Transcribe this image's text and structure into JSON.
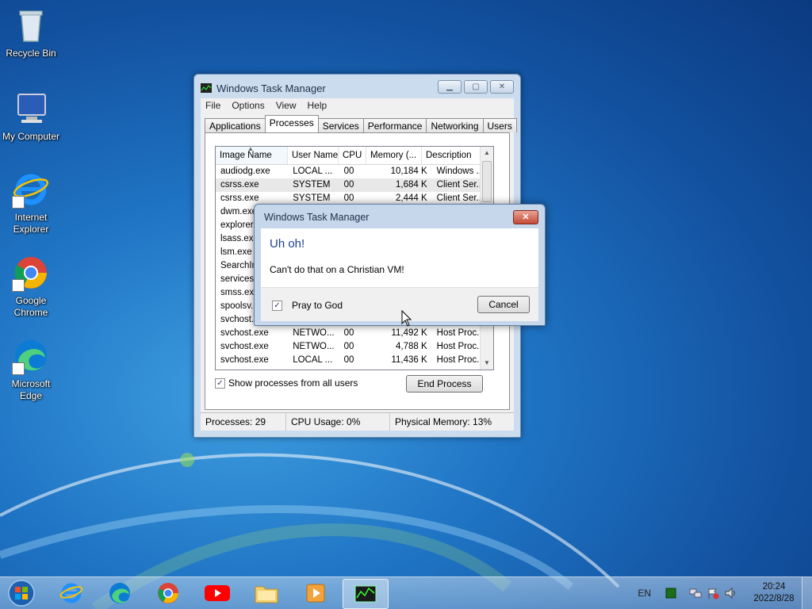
{
  "desktop": {
    "icons": [
      {
        "label": "Recycle Bin"
      },
      {
        "label": "My Computer"
      },
      {
        "label": "Internet Explorer"
      },
      {
        "label": "Google Chrome"
      },
      {
        "label": "Microsoft Edge"
      }
    ]
  },
  "task_manager": {
    "title": "Windows Task Manager",
    "menu": [
      "File",
      "Options",
      "View",
      "Help"
    ],
    "tabs": [
      "Applications",
      "Processes",
      "Services",
      "Performance",
      "Networking",
      "Users"
    ],
    "active_tab": "Processes",
    "columns": [
      "Image Name",
      "User Name",
      "CPU",
      "Memory (...",
      "Description"
    ],
    "rows": [
      {
        "image": "audiodg.exe",
        "user": "LOCAL ...",
        "cpu": "00",
        "mem": "10,184 K",
        "desc": "Windows ..."
      },
      {
        "image": "csrss.exe",
        "user": "SYSTEM",
        "cpu": "00",
        "mem": "1,684 K",
        "desc": "Client Ser..."
      },
      {
        "image": "csrss.exe",
        "user": "SYSTEM",
        "cpu": "00",
        "mem": "2,444 K",
        "desc": "Client Ser..."
      },
      {
        "image": "dwm.exe",
        "user": "",
        "cpu": "",
        "mem": "",
        "desc": ""
      },
      {
        "image": "explorer.exe",
        "user": "",
        "cpu": "",
        "mem": "",
        "desc": ""
      },
      {
        "image": "lsass.exe",
        "user": "",
        "cpu": "",
        "mem": "",
        "desc": ""
      },
      {
        "image": "lsm.exe",
        "user": "",
        "cpu": "",
        "mem": "",
        "desc": ""
      },
      {
        "image": "SearchIndexer.exe",
        "user": "",
        "cpu": "",
        "mem": "",
        "desc": ""
      },
      {
        "image": "services.exe",
        "user": "",
        "cpu": "",
        "mem": "",
        "desc": ""
      },
      {
        "image": "smss.exe",
        "user": "",
        "cpu": "",
        "mem": "",
        "desc": ""
      },
      {
        "image": "spoolsv.exe",
        "user": "",
        "cpu": "",
        "mem": "",
        "desc": ""
      },
      {
        "image": "svchost.exe",
        "user": "",
        "cpu": "",
        "mem": "",
        "desc": ""
      },
      {
        "image": "svchost.exe",
        "user": "NETWO...",
        "cpu": "00",
        "mem": "11,492 K",
        "desc": "Host Proc..."
      },
      {
        "image": "svchost.exe",
        "user": "NETWO...",
        "cpu": "00",
        "mem": "4,788 K",
        "desc": "Host Proc..."
      },
      {
        "image": "svchost.exe",
        "user": "LOCAL ...",
        "cpu": "00",
        "mem": "11,436 K",
        "desc": "Host Proc..."
      }
    ],
    "show_all_label": "Show processes from all users",
    "show_all_checked": true,
    "end_process_label": "End Process",
    "status": {
      "processes": "Processes: 29",
      "cpu": "CPU Usage: 0%",
      "memory": "Physical Memory: 13%"
    }
  },
  "dialog": {
    "title": "Windows Task Manager",
    "heading": "Uh oh!",
    "message": "Can't do that on a Christian VM!",
    "checkbox_label": "Pray to God",
    "checkbox_checked": true,
    "cancel_label": "Cancel"
  },
  "taskbar": {
    "apps": [
      "start-orb",
      "internet-explorer",
      "microsoft-edge",
      "google-chrome",
      "youtube",
      "file-explorer",
      "media-player",
      "task-manager"
    ],
    "language": "EN",
    "time": "20:24",
    "date": "2022/8/28"
  },
  "colors": {
    "desktop_blue": "#1f74c4",
    "dialog_heading": "#1e3f8f",
    "close_red": "#c44a35"
  }
}
